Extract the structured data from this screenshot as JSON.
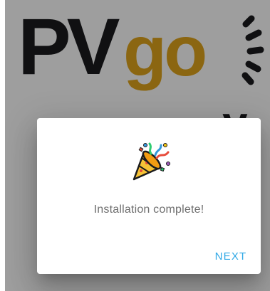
{
  "background": {
    "logo_text_pv": "PV",
    "logo_text_go": "go",
    "partial_word": "y"
  },
  "dialog": {
    "icon": "party-popper-icon",
    "message": "Installation complete!",
    "next_label": "NEXT"
  },
  "colors": {
    "logo_dark": "#1b1b1d",
    "logo_gold": "#e0a51c",
    "accent": "#2fa8e6",
    "message_text": "#6e6e6e"
  }
}
